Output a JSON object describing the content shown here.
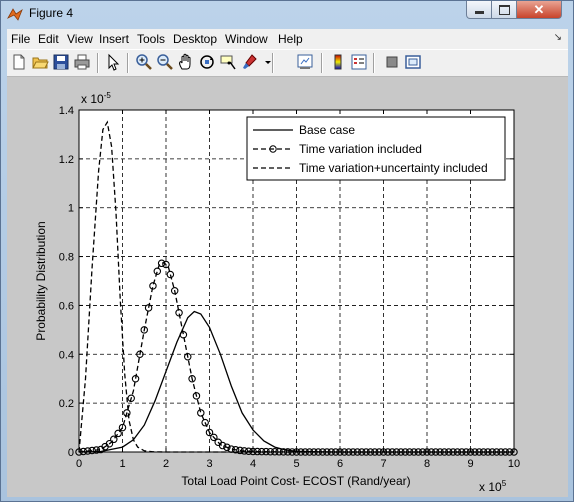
{
  "window": {
    "title": "Figure 4",
    "close_glyph": "✕"
  },
  "menu": {
    "items": [
      "File",
      "Edit",
      "View",
      "Insert",
      "Tools",
      "Desktop",
      "Window",
      "Help"
    ],
    "dock_glyph": "↘"
  },
  "toolbar": {
    "icons": [
      "new-figure-icon",
      "open-file-icon",
      "save-icon",
      "print-icon",
      "edit-plot-arrow-icon",
      "zoom-in-icon",
      "zoom-out-icon",
      "pan-hand-icon",
      "rotate-3d-icon",
      "data-cursor-icon",
      "brush-icon",
      "brush-dropdown-icon",
      "link-plot-icon",
      "colorbar-icon",
      "legend-icon",
      "hide-plot-tools-icon",
      "show-plot-tools-icon"
    ]
  },
  "chart_data": {
    "type": "line",
    "xlabel": "Total Load Point Cost- ECOST (Rand/year)",
    "ylabel": "Probability Distribution",
    "x_exponent": "x 10",
    "x_exponent_power": "5",
    "y_exponent": "x 10",
    "y_exponent_power": "-5",
    "xlim": [
      0,
      10
    ],
    "ylim": [
      0,
      1.4
    ],
    "x_ticks": [
      0,
      1,
      2,
      3,
      4,
      5,
      6,
      7,
      8,
      9,
      10
    ],
    "x_tick_labels": [
      "0",
      "1",
      "2",
      "3",
      "4",
      "5",
      "6",
      "7",
      "8",
      "9",
      "10"
    ],
    "y_ticks": [
      0,
      0.2,
      0.4,
      0.6,
      0.8,
      1,
      1.2,
      1.4
    ],
    "y_tick_labels": [
      "0",
      "0.2",
      "0.4",
      "0.6",
      "0.8",
      "1",
      "1.2",
      "1.4"
    ],
    "grid": true,
    "legend_position": "top-right",
    "series": [
      {
        "name": "Base case",
        "style": "solid",
        "marker": "none",
        "x": [
          0,
          0.5,
          1,
          1.25,
          1.5,
          1.75,
          2,
          2.25,
          2.5,
          2.65,
          2.8,
          3,
          3.25,
          3.5,
          3.75,
          4,
          4.25,
          4.5,
          4.75,
          5,
          5.5,
          6,
          7,
          8,
          9,
          10
        ],
        "y": [
          0,
          0.002,
          0.02,
          0.05,
          0.11,
          0.21,
          0.33,
          0.45,
          0.55,
          0.575,
          0.565,
          0.51,
          0.4,
          0.27,
          0.16,
          0.09,
          0.045,
          0.02,
          0.008,
          0.003,
          0.001,
          0,
          0,
          0,
          0,
          0
        ]
      },
      {
        "name": "Time variation included",
        "style": "dashed",
        "marker": "circle",
        "x": [
          0,
          0.5,
          0.75,
          1,
          1.25,
          1.5,
          1.7,
          1.85,
          1.95,
          2.05,
          2.2,
          2.4,
          2.6,
          2.8,
          3,
          3.25,
          3.5,
          3.75,
          4,
          4.5,
          5,
          6,
          7,
          8,
          9,
          10
        ],
        "y": [
          0,
          0.01,
          0.04,
          0.1,
          0.25,
          0.5,
          0.68,
          0.77,
          0.775,
          0.76,
          0.66,
          0.48,
          0.3,
          0.16,
          0.08,
          0.03,
          0.012,
          0.005,
          0.002,
          0.001,
          0,
          0,
          0,
          0,
          0,
          0
        ]
      },
      {
        "name": "Time variation+uncertainty included",
        "style": "dashed",
        "marker": "none",
        "x": [
          0,
          0.15,
          0.3,
          0.45,
          0.55,
          0.65,
          0.75,
          0.85,
          0.95,
          1.05,
          1.15,
          1.25,
          1.35,
          1.5,
          1.7,
          2,
          2.5,
          3,
          4,
          5,
          6,
          7,
          8,
          9,
          10
        ],
        "y": [
          0,
          0.3,
          0.75,
          1.15,
          1.32,
          1.35,
          1.25,
          0.98,
          0.62,
          0.32,
          0.13,
          0.05,
          0.02,
          0.005,
          0.001,
          0,
          0,
          0,
          0,
          0,
          0,
          0,
          0,
          0,
          0
        ]
      }
    ]
  }
}
